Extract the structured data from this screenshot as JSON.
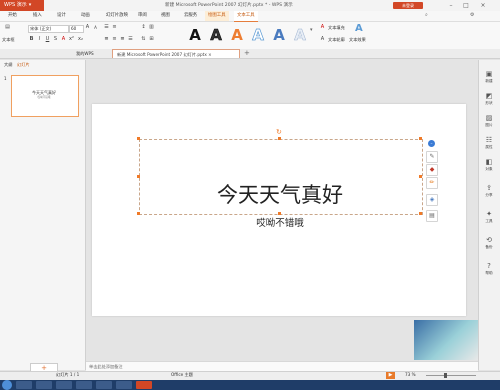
{
  "titlebar": {
    "app_menu": "WPS 演示",
    "doc_title": "新建 Microsoft PowerPoint 2007 幻灯片.pptx * - WPS 演示",
    "login": "未登录"
  },
  "menu_tabs": [
    "开始",
    "插入",
    "设计",
    "动画",
    "幻灯片放映",
    "审阅",
    "视图",
    "云服务",
    "绘图工具",
    "文本工具"
  ],
  "ribbon": {
    "text_edit": "文本框",
    "font_name": "宋体 (正文)",
    "font_size": "60",
    "text_fill": "文本填充",
    "text_outline": "文本轮廓",
    "text_effects": "文本效果",
    "find_command": "查找命令、搜索模板"
  },
  "doc_tabs": {
    "my_wps": "我的WPS",
    "doc": "新建 Microsoft PowerPoint 2007 幻灯片.pptx"
  },
  "left_pane": {
    "tab_outline": "大纲",
    "tab_slides": "幻灯片",
    "slide_number": "1",
    "thumb_title": "今天天气真好",
    "thumb_sub": "哎呦不错哦"
  },
  "slide": {
    "title": "今天天气真好",
    "subtitle": "哎呦不错哦"
  },
  "right_sidebar": [
    "新建",
    "形状",
    "图片",
    "属性",
    "对象",
    "分享",
    "工具",
    "备份",
    "帮助"
  ],
  "notes_placeholder": "单击此处添加备注",
  "status": {
    "slide_count": "幻灯片 1 / 1",
    "theme": "Office 主题",
    "zoom": "73 %"
  },
  "colors": {
    "accent": "#d24726",
    "selection": "#f07a28",
    "taskbar": "#1f3d68"
  }
}
